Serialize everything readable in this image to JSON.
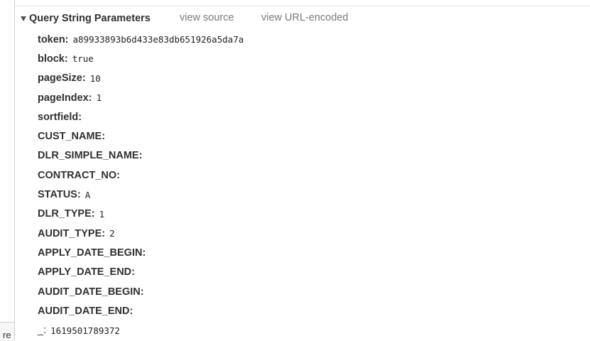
{
  "left_panel": {
    "bottom_label": "re"
  },
  "section": {
    "title": "Query String Parameters",
    "links": {
      "view_source": "view source",
      "view_url_encoded": "view URL-encoded"
    }
  },
  "params": [
    {
      "key": "token",
      "value": "a89933893b6d433e83db651926a5da7a"
    },
    {
      "key": "block",
      "value": "true"
    },
    {
      "key": "pageSize",
      "value": "10"
    },
    {
      "key": "pageIndex",
      "value": "1"
    },
    {
      "key": "sortfield",
      "value": ""
    },
    {
      "key": "CUST_NAME",
      "value": ""
    },
    {
      "key": "DLR_SIMPLE_NAME",
      "value": ""
    },
    {
      "key": "CONTRACT_NO",
      "value": ""
    },
    {
      "key": "STATUS",
      "value": "A"
    },
    {
      "key": "DLR_TYPE",
      "value": "1"
    },
    {
      "key": "AUDIT_TYPE",
      "value": "2"
    },
    {
      "key": "APPLY_DATE_BEGIN",
      "value": ""
    },
    {
      "key": "APPLY_DATE_END",
      "value": ""
    },
    {
      "key": "AUDIT_DATE_BEGIN",
      "value": ""
    },
    {
      "key": "AUDIT_DATE_END",
      "value": ""
    },
    {
      "key": "_",
      "value": "1619501789372"
    }
  ]
}
